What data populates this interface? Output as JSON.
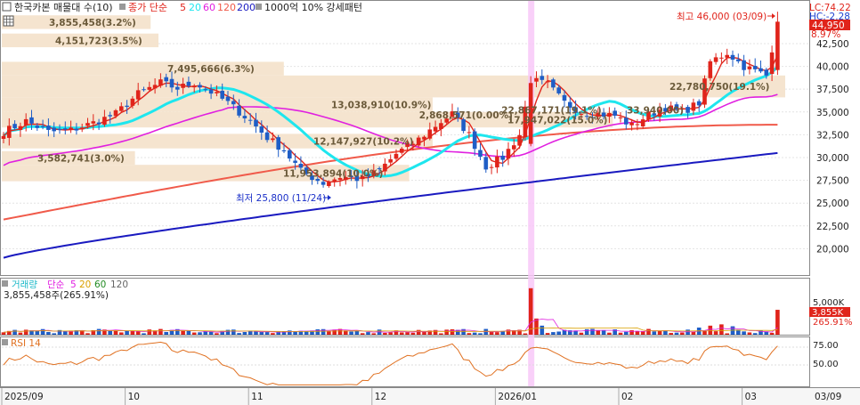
{
  "header": {
    "title": "한국카본 매물대 수(10)",
    "ma_type": "종가 단순",
    "ma_periods": [
      "5",
      "20",
      "60",
      "120",
      "200"
    ],
    "pattern": "1000억 10% 강세패턴"
  },
  "top_right": {
    "lc": "LC:74.22",
    "hc": "HC:-2.28",
    "pct": "8.97%",
    "price": "44,950"
  },
  "annotations": {
    "high": "최고 46,000 (03/09)",
    "low": "최저 25,800 (11/24)"
  },
  "volume_panel": {
    "title": "거래량",
    "ma_type": "단순",
    "ma_periods": [
      "5",
      "20",
      "60",
      "120"
    ],
    "info": "3,855,458주(265.91%)",
    "axis_label": "5,000K",
    "value_box": "3,855K",
    "pct_box": "265.91%"
  },
  "rsi_panel": {
    "title": "RSI 14",
    "ticks": [
      "75.00",
      "50.00"
    ]
  },
  "x_axis": {
    "labels": [
      {
        "text": "2025/09",
        "i": 0
      },
      {
        "text": "10",
        "i": 22
      },
      {
        "text": "11",
        "i": 44
      },
      {
        "text": "12",
        "i": 66
      },
      {
        "text": "2026/01",
        "i": 88
      },
      {
        "text": "02",
        "i": 110
      },
      {
        "text": "03",
        "i": 132
      }
    ],
    "right_label": "03/09"
  },
  "colors": {
    "up": "#e0241b",
    "down": "#1f5ec6",
    "ma5": "#e0241b",
    "ma20": "#1ee6ee",
    "ma60": "#e020e0",
    "ma120": "#f05a4a",
    "ma200": "#1a1ac0",
    "band": "#f5e4cf",
    "band_text": "#6b5a3a",
    "highlight": "#f8c8f8"
  },
  "chart_data": {
    "type": "candlestick",
    "y_ticks": [
      20000,
      22500,
      25000,
      27500,
      30000,
      32500,
      35000,
      37500,
      40000,
      42500
    ],
    "y_tick_labels": [
      "20,000",
      "22,500",
      "25,000",
      "27,500",
      "30,000",
      "32,500",
      "35,000",
      "37,500",
      "40,000",
      "42,500"
    ],
    "ylim": [
      17500,
      46500
    ],
    "highlight_index": 94,
    "volume_profile": [
      {
        "label": "3,855,458(3.2%)",
        "top": 45600,
        "bottom": 44100,
        "length": 0.19
      },
      {
        "label": "4,151,723(3.5%)",
        "top": 43600,
        "bottom": 42100,
        "length": 0.2
      },
      {
        "label": "7,495,666(6.3%)",
        "top": 40500,
        "bottom": 39000,
        "length": 0.36
      },
      {
        "label": "22,780,750(19.1%)",
        "top": 39000,
        "bottom": 36600,
        "length": 1.0
      },
      {
        "label": "13,038,910(10.9%)",
        "top": 36600,
        "bottom": 35000,
        "length": 0.55
      },
      {
        "label": "17,947,022(15.0%)",
        "top": 35000,
        "bottom": 33300,
        "length": 0.78
      },
      {
        "label": "12,147,927(10.2%)",
        "top": 32600,
        "bottom": 31000,
        "length": 0.55
      },
      {
        "label": "3,582,741(3.0%)",
        "top": 30700,
        "bottom": 29200,
        "length": 0.17
      },
      {
        "label": "11,953,894(10.0%)",
        "top": 29200,
        "bottom": 27400,
        "length": 0.52
      }
    ],
    "band_labels_extra": [
      {
        "label": "2,868,571(0.00%)",
        "y": 34700,
        "x": 0.535
      },
      {
        "label": "22,867,171(19.1%)",
        "y": 35200,
        "x": 0.64
      },
      {
        "label": "33,940,00)",
        "y": 35200,
        "x": 0.8
      }
    ],
    "anchors_close": [
      [
        0,
        32800
      ],
      [
        4,
        34000
      ],
      [
        8,
        32800
      ],
      [
        12,
        33000
      ],
      [
        16,
        33800
      ],
      [
        20,
        34800
      ],
      [
        24,
        37000
      ],
      [
        28,
        38200
      ],
      [
        31,
        37600
      ],
      [
        34,
        38200
      ],
      [
        37,
        37200
      ],
      [
        40,
        36000
      ],
      [
        44,
        34000
      ],
      [
        47,
        32200
      ],
      [
        50,
        30800
      ],
      [
        53,
        28500
      ],
      [
        57,
        27200
      ],
      [
        60,
        27900
      ],
      [
        64,
        27600
      ],
      [
        67,
        28600
      ],
      [
        70,
        30400
      ],
      [
        74,
        32000
      ],
      [
        77,
        33500
      ],
      [
        80,
        34800
      ],
      [
        83,
        32500
      ],
      [
        86,
        29000
      ],
      [
        89,
        30000
      ],
      [
        92,
        32500
      ],
      [
        94,
        38500
      ],
      [
        97,
        38000
      ],
      [
        100,
        36000
      ],
      [
        103,
        35000
      ],
      [
        106,
        34800
      ],
      [
        109,
        34600
      ],
      [
        112,
        33500
      ],
      [
        115,
        34700
      ],
      [
        118,
        35500
      ],
      [
        121,
        35000
      ],
      [
        124,
        36000
      ],
      [
        126,
        40500
      ],
      [
        129,
        41500
      ],
      [
        132,
        40000
      ],
      [
        134,
        39500
      ],
      [
        136,
        39000
      ],
      [
        138,
        44900
      ]
    ],
    "n": 139,
    "volume": {
      "max": 8000,
      "base_min": 200,
      "base_max": 900,
      "spikes": [
        [
          94,
          7200
        ],
        [
          95,
          2500
        ],
        [
          96,
          1400
        ],
        [
          124,
          1100
        ],
        [
          126,
          1400
        ],
        [
          128,
          1600
        ],
        [
          130,
          1300
        ],
        [
          138,
          3855
        ]
      ]
    },
    "rsi": {
      "ylim": [
        20,
        85
      ]
    }
  }
}
